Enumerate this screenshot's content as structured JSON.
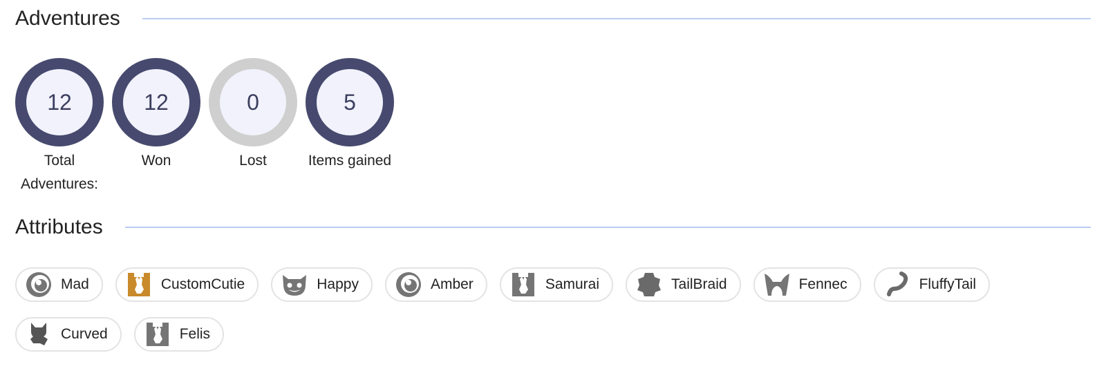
{
  "adventures": {
    "title": "Adventures",
    "stats": [
      {
        "value": "12",
        "label": "Total Adventures:"
      },
      {
        "value": "12",
        "label": "Won"
      },
      {
        "value": "0",
        "label": "Lost"
      },
      {
        "value": "5",
        "label": "Items gained"
      }
    ]
  },
  "attributes": {
    "title": "Attributes",
    "chips": [
      {
        "label": "Mad",
        "icon": "eye-icon",
        "icon_color": "#757575"
      },
      {
        "label": "CustomCutie",
        "icon": "cat-body-icon",
        "icon_color": "#c98a2b"
      },
      {
        "label": "Happy",
        "icon": "smile-face-icon",
        "icon_color": "#757575"
      },
      {
        "label": "Amber",
        "icon": "eye-icon",
        "icon_color": "#757575"
      },
      {
        "label": "Samurai",
        "icon": "cat-body-icon",
        "icon_color": "#757575"
      },
      {
        "label": "TailBraid",
        "icon": "braid-icon",
        "icon_color": "#6a6a6a"
      },
      {
        "label": "Fennec",
        "icon": "ears-icon",
        "icon_color": "#757575"
      },
      {
        "label": "FluffyTail",
        "icon": "tail-icon",
        "icon_color": "#6a6a6a"
      },
      {
        "label": "Curved",
        "icon": "cat-silhouette-icon",
        "icon_color": "#555555"
      },
      {
        "label": "Felis",
        "icon": "cat-body-icon",
        "icon_color": "#757575"
      }
    ]
  },
  "colors": {
    "ring_active": "#474a6e",
    "ring_empty": "#cfcfcf",
    "ring_fill": "#f1f2fb",
    "rule": "#b8cdf2"
  }
}
